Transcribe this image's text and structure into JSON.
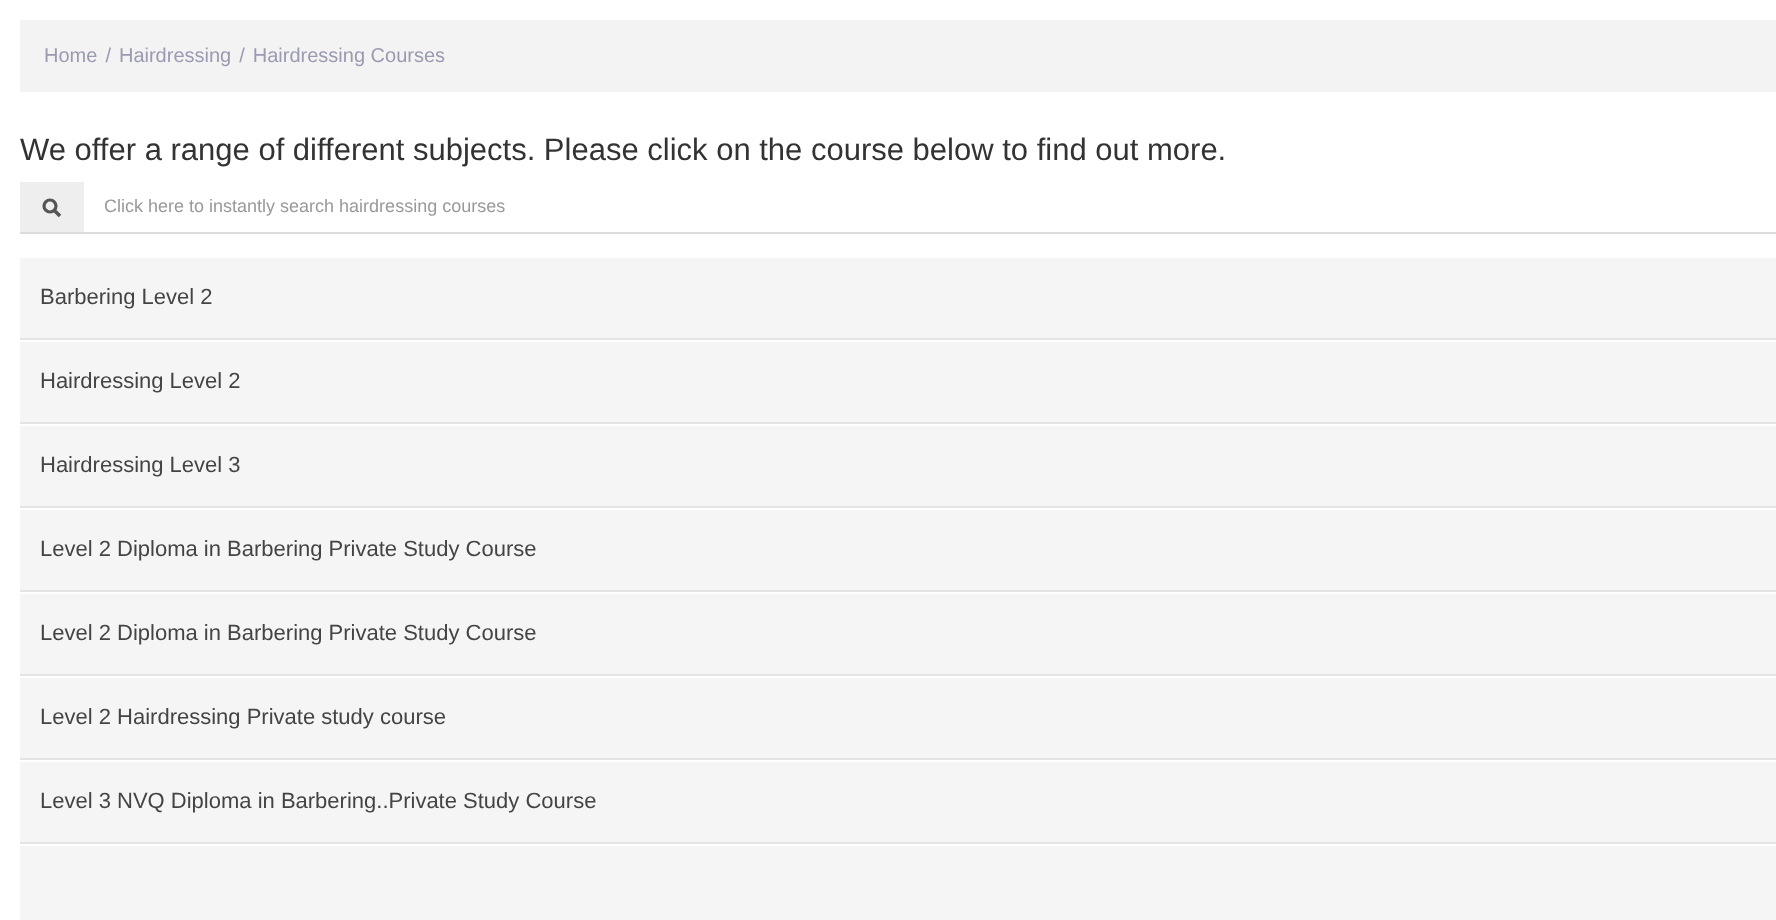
{
  "breadcrumb": [
    "Home",
    "Hairdressing",
    "Hairdressing Courses"
  ],
  "breadcrumb_separator": "/",
  "intro": "We offer a range of different subjects. Please click on the course below to find out more.",
  "search": {
    "placeholder": "Click here to instantly search hairdressing courses"
  },
  "courses": [
    "Barbering Level 2",
    "Hairdressing Level 2",
    "Hairdressing Level 3",
    "Level 2 Diploma in Barbering Private Study Course",
    "Level 2 Diploma in Barbering Private Study Course",
    "Level 2 Hairdressing Private study course",
    "Level 3 NVQ Diploma in Barbering..Private Study Course"
  ]
}
